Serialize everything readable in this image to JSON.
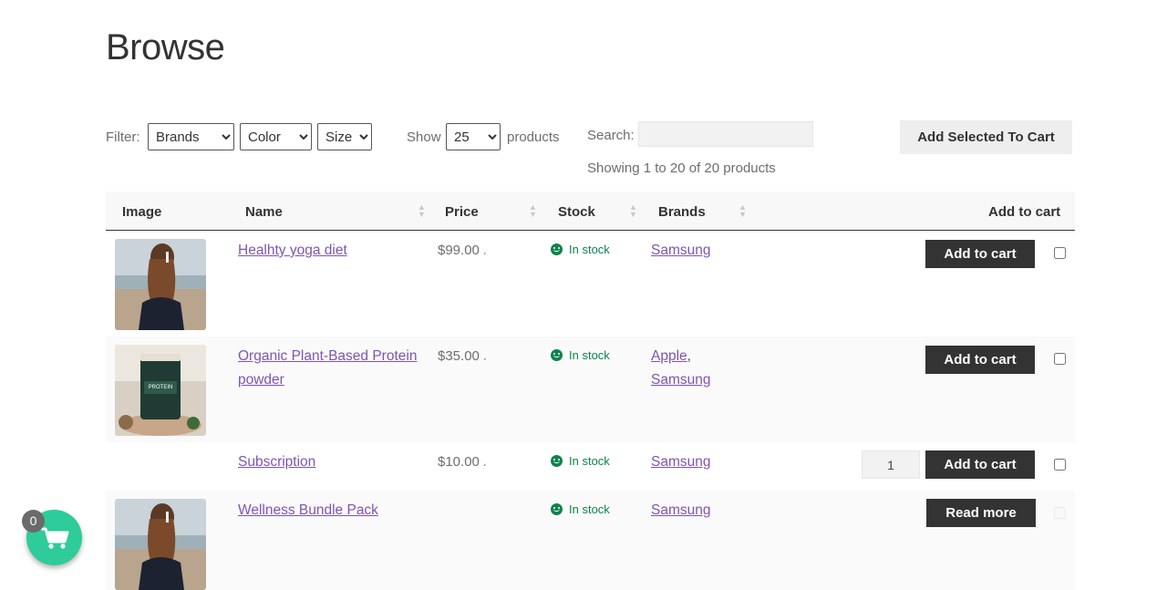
{
  "page": {
    "title": "Browse"
  },
  "controls": {
    "filter_label": "Filter:",
    "filters": [
      "Brands",
      "Color",
      "Size"
    ],
    "show_label": "Show",
    "show_value": "25",
    "products_label": "products",
    "search_label": "Search:",
    "search_value": "",
    "showing_text": "Showing 1 to 20 of 20 products",
    "add_selected_label": "Add Selected To Cart"
  },
  "table": {
    "headers": [
      "Image",
      "Name",
      "Price",
      "Stock",
      "Brands",
      "Add to cart"
    ],
    "rows": [
      {
        "name": "Healhty yoga diet",
        "price": "$99.00",
        "price_suffix": "،",
        "stock": "In stock",
        "brands": [
          "Samsung"
        ],
        "action": "Add to cart",
        "image": "woman-beach-photo"
      },
      {
        "name": "Organic Plant-Based Protein powder",
        "price": "$35.00",
        "price_suffix": "،",
        "stock": "In stock",
        "brands": [
          "Apple",
          "Samsung"
        ],
        "action": "Add to cart",
        "image": "protein-powder-photo"
      },
      {
        "name": "Subscription",
        "price": "$10.00",
        "price_suffix": "،",
        "stock": "In stock",
        "brands": [
          "Samsung"
        ],
        "action": "Add to cart",
        "quantity": "1"
      },
      {
        "name": "Wellness Bundle Pack",
        "price": "",
        "stock": "In stock",
        "brands": [
          "Samsung"
        ],
        "action": "Read more",
        "image": "woman-beach-photo"
      }
    ]
  },
  "cart": {
    "count": "0",
    "icon": "cart-icon"
  },
  "colors": {
    "accent": "#7f54b3",
    "button": "#333333",
    "stock": "#0f834d",
    "cart_fab": "#2ecc9a"
  }
}
